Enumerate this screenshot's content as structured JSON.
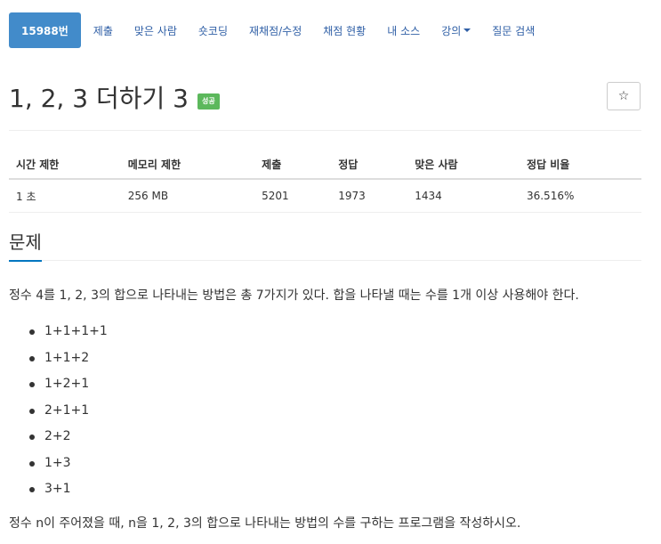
{
  "nav": {
    "items": [
      {
        "label": "15988번",
        "active": true
      },
      {
        "label": "제출"
      },
      {
        "label": "맞은 사람"
      },
      {
        "label": "숏코딩"
      },
      {
        "label": "재채점/수정"
      },
      {
        "label": "채점 현황"
      },
      {
        "label": "내 소스"
      },
      {
        "label": "강의",
        "dropdown": true
      },
      {
        "label": "질문 검색"
      }
    ]
  },
  "problem": {
    "title": "1, 2, 3 더하기 3",
    "status_badge": "성공",
    "star_icon": "☆"
  },
  "info_table": {
    "headers": [
      "시간 제한",
      "메모리 제한",
      "제출",
      "정답",
      "맞은 사람",
      "정답 비율"
    ],
    "row": [
      "1 초",
      "256 MB",
      "5201",
      "1973",
      "1434",
      "36.516%"
    ]
  },
  "section": {
    "title": "문제",
    "paragraph_1": "정수 4를 1, 2, 3의 합으로 나타내는 방법은 총 7가지가 있다. 합을 나타낼 때는 수를 1개 이상 사용해야 한다.",
    "list": [
      "1+1+1+1",
      "1+1+2",
      "1+2+1",
      "2+1+1",
      "2+2",
      "1+3",
      "3+1"
    ],
    "paragraph_2": "정수 n이 주어졌을 때, n을 1, 2, 3의 합으로 나타내는 방법의 수를 구하는 프로그램을 작성하시오."
  },
  "colors": {
    "active_tab": "#428bca",
    "link": "#2f5fa6",
    "success_badge": "#5cb85c",
    "section_underline": "#0076c0"
  }
}
